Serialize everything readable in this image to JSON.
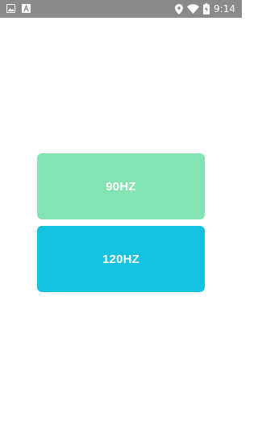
{
  "status_bar": {
    "time": "9:14",
    "icons": [
      "image-icon",
      "notification-a-icon",
      "location-icon",
      "wifi-icon",
      "battery-charging-icon"
    ]
  },
  "buttons": {
    "hz90_label": "90HZ",
    "hz120_label": "120HZ"
  },
  "colors": {
    "status_bar": "#8a8a8a",
    "hz90": "#84e4b1",
    "hz120": "#13c2df",
    "label": "#ffffff",
    "background": "#ffffff"
  }
}
